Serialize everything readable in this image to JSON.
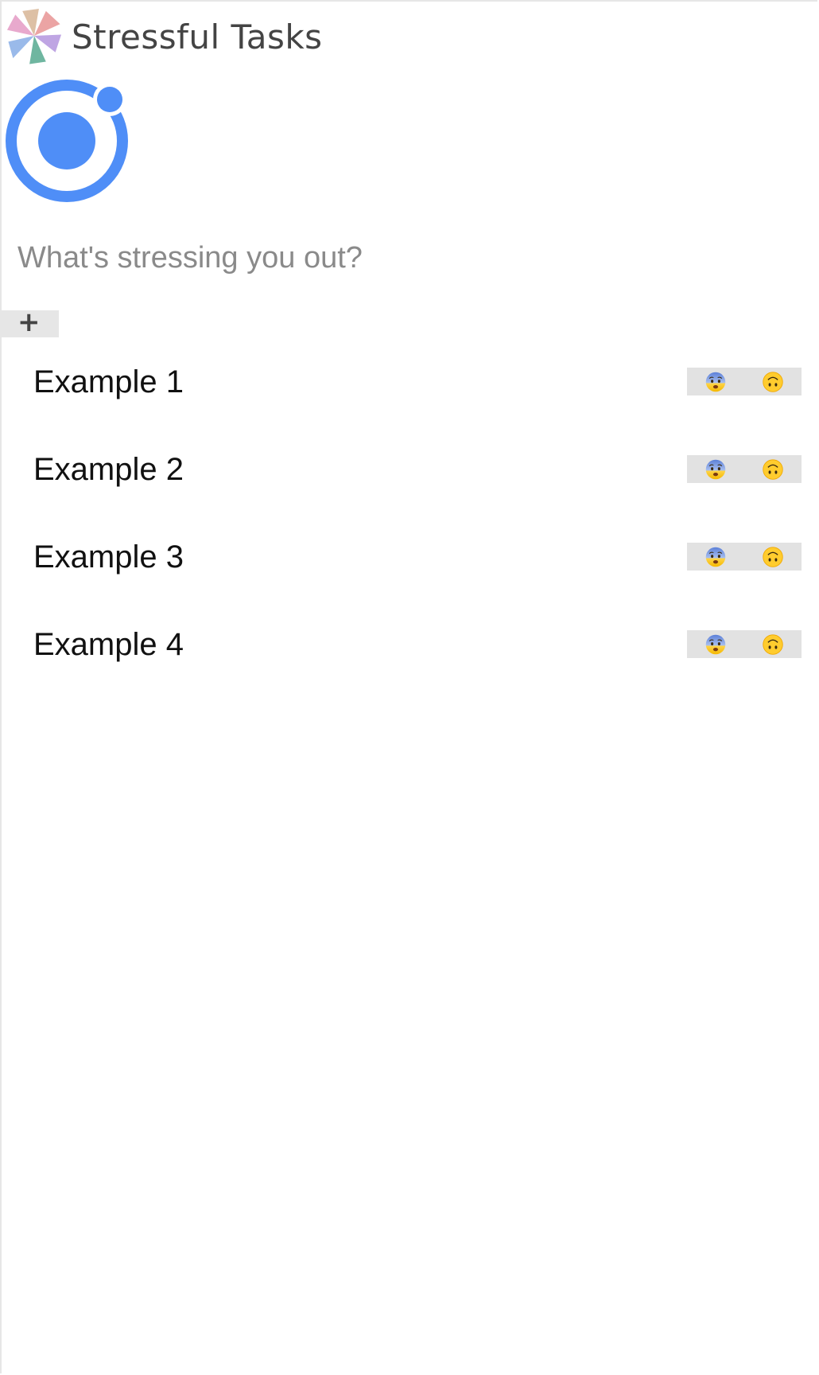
{
  "app": {
    "title": "Stressful Tasks"
  },
  "input": {
    "placeholder": "What's stressing you out?",
    "value": ""
  },
  "add_button": {
    "label": "+"
  },
  "tasks": [
    {
      "label": "Example 1",
      "actions": [
        "anxious-face-icon",
        "upside-down-face-icon"
      ]
    },
    {
      "label": "Example 2",
      "actions": [
        "anxious-face-icon",
        "upside-down-face-icon"
      ]
    },
    {
      "label": "Example 3",
      "actions": [
        "anxious-face-icon",
        "upside-down-face-icon"
      ]
    },
    {
      "label": "Example 4",
      "actions": [
        "anxious-face-icon",
        "upside-down-face-icon"
      ]
    }
  ],
  "colors": {
    "ionic_blue": "#4f8ef7",
    "button_gray": "#e6e6e6",
    "placeholder_gray": "#8a8a8a"
  }
}
